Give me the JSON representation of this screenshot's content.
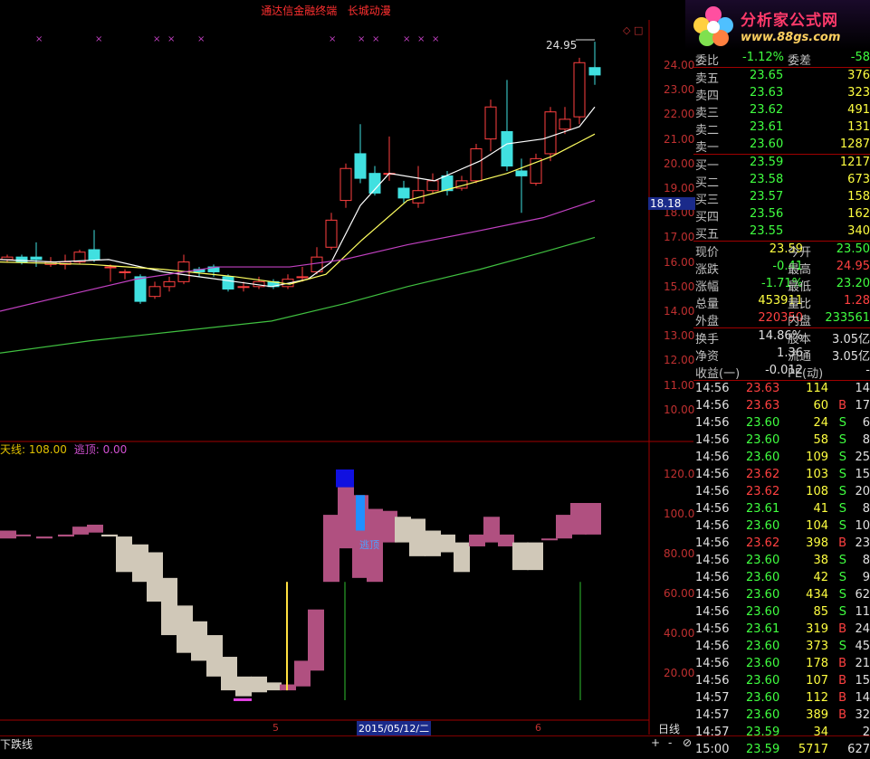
{
  "app": {
    "title": "通达信金融终端",
    "subtitle": "长城动漫",
    "logo_name": "分析家公式网",
    "logo_url": "www.88gs.com",
    "top_right_icons": "◇ □"
  },
  "main_chart": {
    "y_ticks": [
      "24.00",
      "23.00",
      "22.00",
      "21.00",
      "20.00",
      "19.00",
      "18.00",
      "17.00",
      "16.00",
      "15.00",
      "14.00",
      "13.00",
      "12.00",
      "11.00",
      "10.00"
    ],
    "high_label": "24.95",
    "price_marker": "18.18"
  },
  "indicator": {
    "label_a": "天线:",
    "value_a": "108.00",
    "label_b": "逃顶:",
    "value_b": "0.00",
    "y_ticks": [
      "120.0",
      "100.0",
      "80.00",
      "60.00",
      "40.00",
      "20.00"
    ],
    "annotation": "逃顶"
  },
  "x_axis": {
    "labels": [
      "5",
      "6"
    ],
    "date_highlight": "2015/05/12/二",
    "period": "日线"
  },
  "bottom_tabs": {
    "tab1": "下跌线",
    "buttons": [
      "+",
      "-",
      "⊘"
    ]
  },
  "quote": {
    "weibi_label": "委比",
    "weibi_value": "-1.12%",
    "weicha_label": "委差",
    "weicha_value": "-58",
    "asks": [
      {
        "label": "卖五",
        "price": "23.65",
        "vol": "376"
      },
      {
        "label": "卖四",
        "price": "23.63",
        "vol": "323"
      },
      {
        "label": "卖三",
        "price": "23.62",
        "vol": "491"
      },
      {
        "label": "卖二",
        "price": "23.61",
        "vol": "131"
      },
      {
        "label": "卖一",
        "price": "23.60",
        "vol": "1287"
      }
    ],
    "bids": [
      {
        "label": "买一",
        "price": "23.59",
        "vol": "1217"
      },
      {
        "label": "买二",
        "price": "23.58",
        "vol": "673"
      },
      {
        "label": "买三",
        "price": "23.57",
        "vol": "158"
      },
      {
        "label": "买四",
        "price": "23.56",
        "vol": "162"
      },
      {
        "label": "买五",
        "price": "23.55",
        "vol": "340"
      }
    ],
    "stats": [
      {
        "l1": "现价",
        "v1": "23.59",
        "l2": "今开",
        "v2": "23.50"
      },
      {
        "l1": "涨跌",
        "v1": "-0.41",
        "l2": "最高",
        "v2": "24.95"
      },
      {
        "l1": "涨幅",
        "v1": "-1.71%",
        "l2": "最低",
        "v2": "23.20"
      },
      {
        "l1": "总量",
        "v1": "453911",
        "l2": "量比",
        "v2": "1.28"
      },
      {
        "l1": "外盘",
        "v1": "220350",
        "l2": "内盘",
        "v2": "233561"
      }
    ],
    "stats2": [
      {
        "l1": "换手",
        "v1": "14.86%",
        "l2": "股本",
        "v2": "3.05亿"
      },
      {
        "l1": "净资",
        "v1": "1.36",
        "l2": "流通",
        "v2": "3.05亿"
      },
      {
        "l1": "收益(一)",
        "v1": "-0.012",
        "l2": "PE(动)",
        "v2": "-"
      }
    ]
  },
  "ticks": [
    {
      "t": "14:56",
      "p": "23.63",
      "v": "114",
      "s": "",
      "n": "14"
    },
    {
      "t": "14:56",
      "p": "23.63",
      "v": "60",
      "s": "B",
      "n": "17"
    },
    {
      "t": "14:56",
      "p": "23.60",
      "v": "24",
      "s": "S",
      "n": "6"
    },
    {
      "t": "14:56",
      "p": "23.60",
      "v": "58",
      "s": "S",
      "n": "8"
    },
    {
      "t": "14:56",
      "p": "23.60",
      "v": "109",
      "s": "S",
      "n": "25"
    },
    {
      "t": "14:56",
      "p": "23.62",
      "v": "103",
      "s": "S",
      "n": "15"
    },
    {
      "t": "14:56",
      "p": "23.62",
      "v": "108",
      "s": "S",
      "n": "20"
    },
    {
      "t": "14:56",
      "p": "23.61",
      "v": "41",
      "s": "S",
      "n": "8"
    },
    {
      "t": "14:56",
      "p": "23.60",
      "v": "104",
      "s": "S",
      "n": "10"
    },
    {
      "t": "14:56",
      "p": "23.62",
      "v": "398",
      "s": "B",
      "n": "23"
    },
    {
      "t": "14:56",
      "p": "23.60",
      "v": "38",
      "s": "S",
      "n": "8"
    },
    {
      "t": "14:56",
      "p": "23.60",
      "v": "42",
      "s": "S",
      "n": "9"
    },
    {
      "t": "14:56",
      "p": "23.60",
      "v": "434",
      "s": "S",
      "n": "62"
    },
    {
      "t": "14:56",
      "p": "23.60",
      "v": "85",
      "s": "S",
      "n": "11"
    },
    {
      "t": "14:56",
      "p": "23.61",
      "v": "319",
      "s": "B",
      "n": "24"
    },
    {
      "t": "14:56",
      "p": "23.60",
      "v": "373",
      "s": "S",
      "n": "45"
    },
    {
      "t": "14:56",
      "p": "23.60",
      "v": "178",
      "s": "B",
      "n": "21"
    },
    {
      "t": "14:56",
      "p": "23.60",
      "v": "107",
      "s": "B",
      "n": "15"
    },
    {
      "t": "14:57",
      "p": "23.60",
      "v": "112",
      "s": "B",
      "n": "14"
    },
    {
      "t": "14:57",
      "p": "23.60",
      "v": "389",
      "s": "B",
      "n": "32"
    },
    {
      "t": "14:57",
      "p": "23.59",
      "v": "34",
      "s": "",
      "n": "2"
    },
    {
      "t": "15:00",
      "p": "23.59",
      "v": "5717",
      "s": "",
      "n": "627"
    }
  ]
}
